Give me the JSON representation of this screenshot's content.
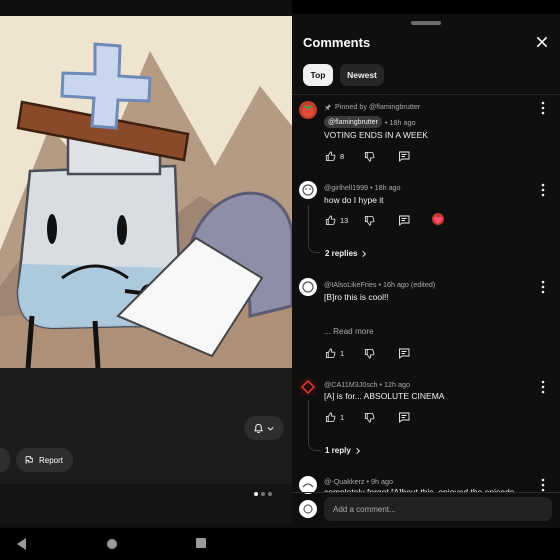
{
  "video": {
    "report_label": "Report",
    "pager": {
      "count": 3,
      "active": 0
    }
  },
  "comments_panel": {
    "title": "Comments",
    "tabs": [
      "Top",
      "Newest"
    ],
    "comments": [
      {
        "pinned_text": "Pinned by @flamingbrutter",
        "author": "@flamingbrutter",
        "age": "• 18h ago",
        "text": "VOTING ENDS IN A WEEK",
        "likes": "8"
      },
      {
        "author": "@girlhell1999",
        "age": "• 18h ago",
        "text": "how do I hype it",
        "likes": "13",
        "replies": "2 replies"
      },
      {
        "author": "@IAlsoLikeFries",
        "age": "• 16h ago (edited)",
        "text": "[B]ro this is cool!!",
        "read_more": "... Read more",
        "likes": "1"
      },
      {
        "author": "@CA11M3J0sch",
        "age": "• 12h ago",
        "text": "[A] is for... ABSOLUTE CINEMA",
        "likes": "1",
        "replies": "1 reply"
      },
      {
        "author": "@-Quakkerz",
        "age": "• 9h ago",
        "text": "completely forgot [A]bout this, enjoyed the episode"
      }
    ],
    "composer_placeholder": "Add a comment..."
  },
  "colors": {
    "panel_bg": "#0f0f0f",
    "text_primary": "#f1f1f1",
    "text_secondary": "#aaaaaa",
    "chip_bg": "#272727"
  }
}
